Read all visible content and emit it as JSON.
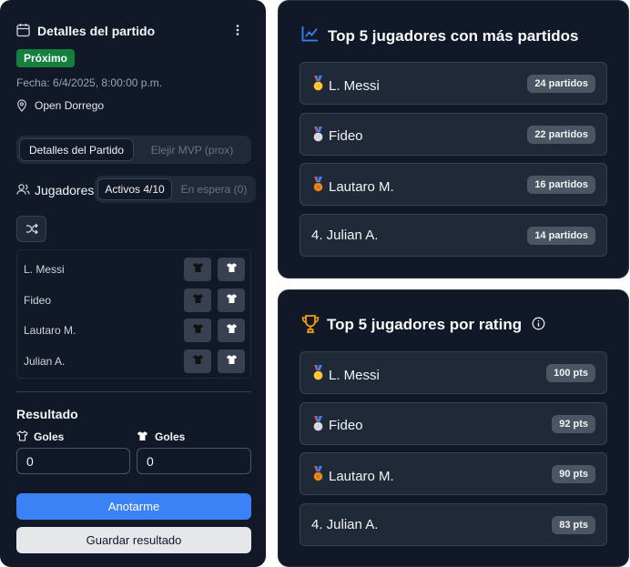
{
  "match": {
    "title": "Detalles del partido",
    "status_badge": "Próximo",
    "date_text": "Fecha: 6/4/2025, 8:00:00 p.m.",
    "location": "Open Dorrego"
  },
  "tabs": {
    "details": "Detalles del Partido",
    "mvp": "Elejir MVP (prox)"
  },
  "players_section": {
    "label": "Jugadores",
    "tab_active": "Activos 4/10",
    "tab_waiting": "En espera (0)",
    "players": [
      "L. Messi",
      "Fideo",
      "Lautaro M.",
      "Julian A."
    ]
  },
  "result": {
    "title": "Resultado",
    "team_dark_label": "Goles",
    "team_light_label": "Goles",
    "team_dark_value": "0",
    "team_light_value": "0",
    "primary_button": "Anotarme",
    "secondary_button": "Guardar resultado"
  },
  "top_matches": {
    "title": "Top 5 jugadores con más partidos",
    "items": [
      {
        "name": "L. Messi",
        "value": "24 partidos",
        "rank_icon": "gold-medal"
      },
      {
        "name": "Fideo",
        "value": "22 partidos",
        "rank_icon": "silver-medal"
      },
      {
        "name": "Lautaro M.",
        "value": "16 partidos",
        "rank_icon": "bronze-medal"
      },
      {
        "name": "4. Julian A.",
        "value": "14 partidos",
        "rank_icon": ""
      }
    ]
  },
  "top_rating": {
    "title": "Top 5 jugadores por rating",
    "items": [
      {
        "name": "L. Messi",
        "value": "100 pts",
        "rank_icon": "gold-medal"
      },
      {
        "name": "Fideo",
        "value": "92 pts",
        "rank_icon": "silver-medal"
      },
      {
        "name": "Lautaro M.",
        "value": "90 pts",
        "rank_icon": "bronze-medal"
      },
      {
        "name": "4. Julian A.",
        "value": "83 pts",
        "rank_icon": ""
      }
    ]
  },
  "colors": {
    "accent": "#3b82f6",
    "card_bg": "#111827",
    "success": "#15803d",
    "trophy": "#f59e0b"
  }
}
